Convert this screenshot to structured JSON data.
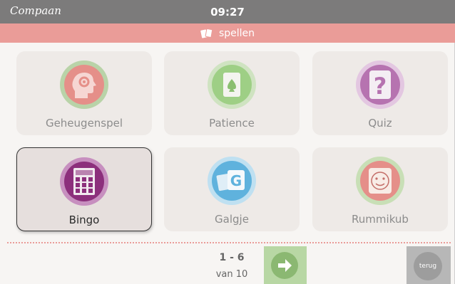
{
  "statusbar": {
    "brand": "Compaan",
    "time": "09:27"
  },
  "header": {
    "title": "spellen",
    "icon": "cards-icon"
  },
  "games": [
    {
      "label": "Geheugenspel",
      "icon": "brain-gear-icon",
      "color": "#e58f89"
    },
    {
      "label": "Patience",
      "icon": "playing-card-icon",
      "color": "#9ecf85"
    },
    {
      "label": "Quiz",
      "icon": "question-mark-icon",
      "color": "#b673b0"
    },
    {
      "label": "Bingo",
      "icon": "bingo-card-icon",
      "color": "#8c2f7c",
      "selected": true
    },
    {
      "label": "Galgje",
      "icon": "letter-tiles-icon",
      "color": "#5fb2dd"
    },
    {
      "label": "Rummikub",
      "icon": "face-tile-icon",
      "color": "#e58f89"
    }
  ],
  "pager": {
    "range": "1 - 6",
    "of": "van 10"
  },
  "buttons": {
    "next_icon": "arrow-right-icon",
    "back_label": "terug"
  }
}
